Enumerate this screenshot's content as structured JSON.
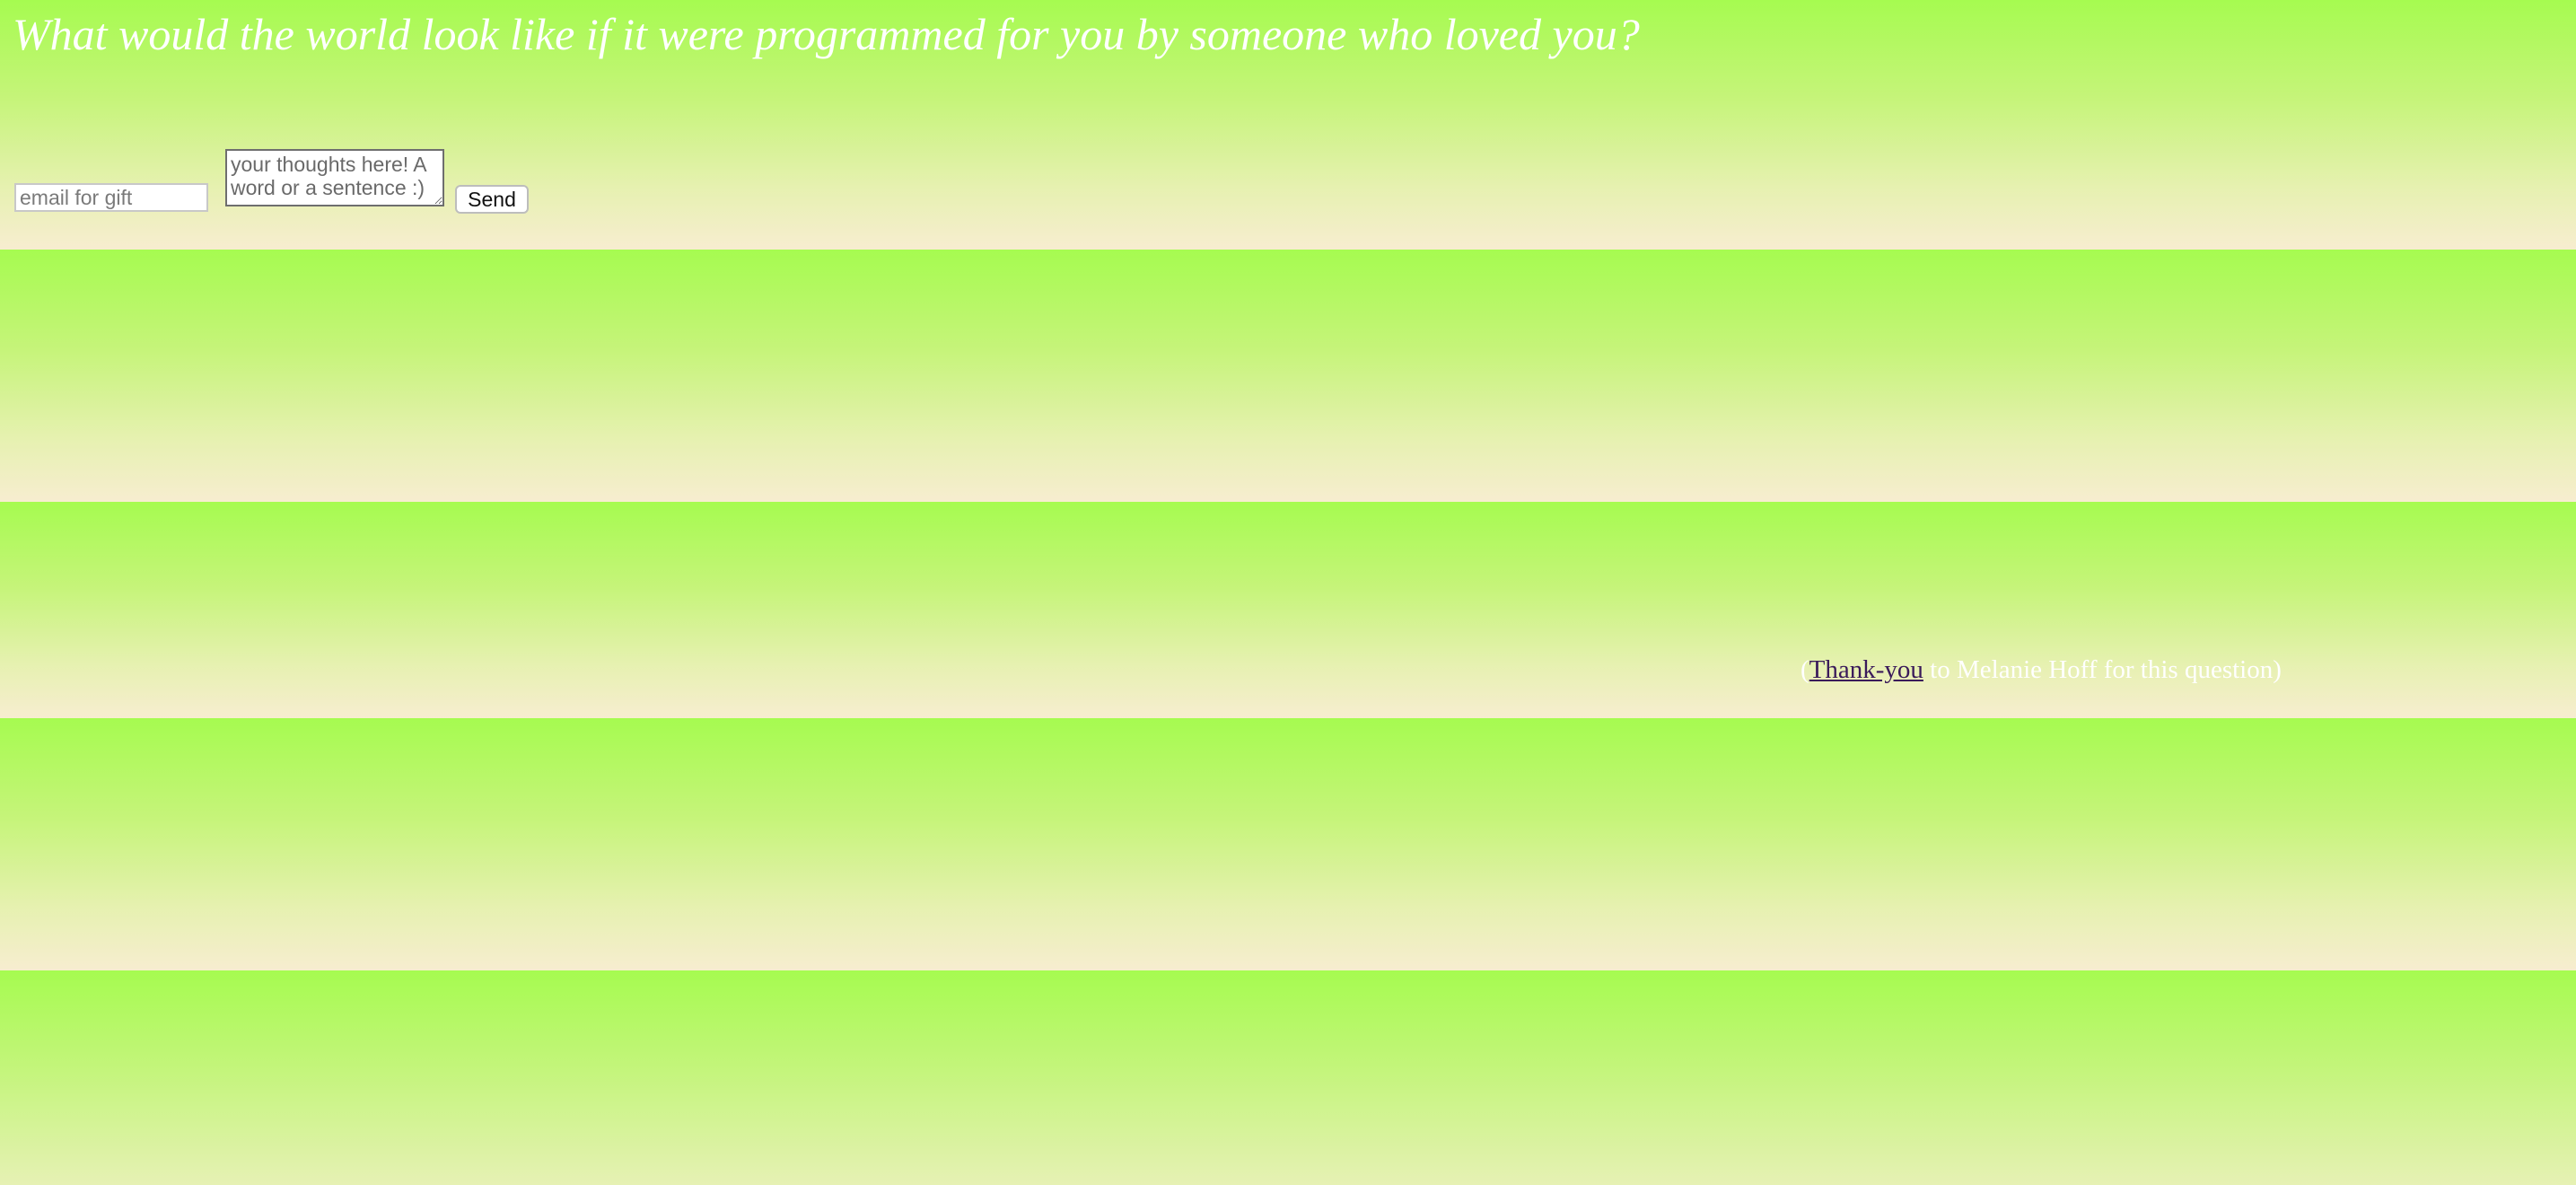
{
  "headline": "What would the world look like if it were programmed for you by someone who loved you?",
  "form": {
    "email_placeholder": "email for gift",
    "thoughts_placeholder": "your thoughts here! A word or a sentence :)",
    "send_label": "Send"
  },
  "credit": {
    "open_paren": "(",
    "link_text": "Thank-you",
    "rest": " to Melanie Hoff for this question)"
  },
  "colors": {
    "background_top": "#a6fb50",
    "background_bottom": "#f7edd0",
    "text": "#ffffff",
    "link": "#3a1a5a"
  }
}
